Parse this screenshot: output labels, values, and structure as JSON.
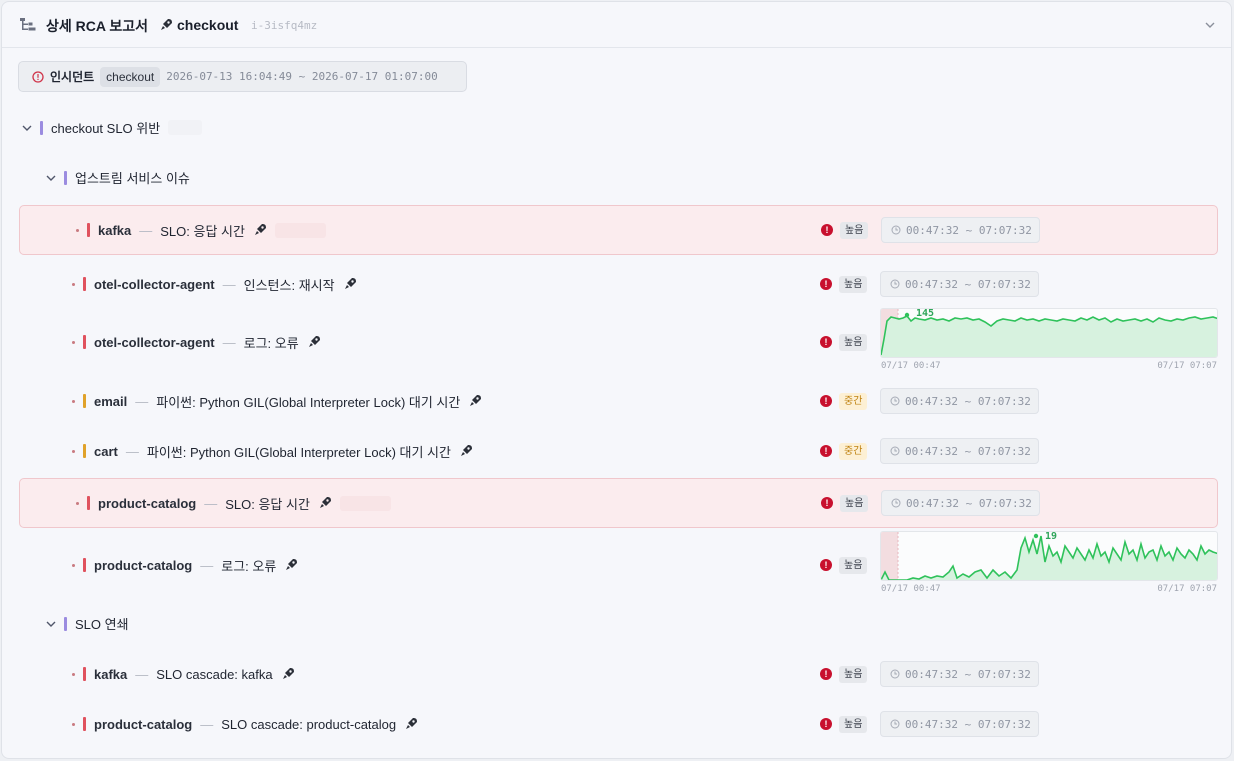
{
  "header": {
    "title": "상세 RCA 보고서",
    "service": "checkout",
    "instance_id": "i-3isfq4mz"
  },
  "incident": {
    "label": "인시던트",
    "service": "checkout",
    "range": "2026-07-13 16:04:49 ~ 2026-07-17 01:07:00"
  },
  "tree": {
    "root": {
      "label": "checkout SLO 위반"
    },
    "group1": {
      "label": "업스트림 서비스 이슈"
    },
    "group2": {
      "label": "SLO 연쇄"
    }
  },
  "rows": [
    {
      "service": "kafka",
      "desc": "SLO: 응답 시간",
      "severity": "높음",
      "time": "00:47:32 ~ 07:07:32"
    },
    {
      "service": "otel-collector-agent",
      "desc": "인스턴스: 재시작",
      "severity": "높음",
      "time": "00:47:32 ~ 07:07:32"
    },
    {
      "service": "otel-collector-agent",
      "desc": "로그: 오류",
      "severity": "높음",
      "spark_start": "07/17 00:47",
      "spark_end": "07/17 07:07",
      "spark_peak": "145"
    },
    {
      "service": "email",
      "desc": "파이썬: Python GIL(Global Interpreter Lock) 대기 시간",
      "severity": "중간",
      "time": "00:47:32 ~ 07:07:32"
    },
    {
      "service": "cart",
      "desc": "파이썬: Python GIL(Global Interpreter Lock) 대기 시간",
      "severity": "중간",
      "time": "00:47:32 ~ 07:07:32"
    },
    {
      "service": "product-catalog",
      "desc": "SLO: 응답 시간",
      "severity": "높음",
      "time": "00:47:32 ~ 07:07:32"
    },
    {
      "service": "product-catalog",
      "desc": "로그: 오류",
      "severity": "높음",
      "spark_start": "07/17 00:47",
      "spark_end": "07/17 07:07",
      "spark_peak": "19"
    },
    {
      "service": "kafka",
      "desc": "SLO cascade: kafka",
      "severity": "높음",
      "time": "00:47:32 ~ 07:07:32"
    },
    {
      "service": "product-catalog",
      "desc": "SLO cascade: product-catalog",
      "severity": "높음",
      "time": "00:47:32 ~ 07:07:32"
    }
  ],
  "colors": {
    "severity_high_bar": "#e0525e",
    "severity_mid_bar": "#e0a22a",
    "tree_bar": "#9b8ce0",
    "spark_line": "#2fc25b",
    "highlight_bg": "#fbecee"
  },
  "icons": {
    "header": "tree-structure-icon",
    "service": "rocket-icon",
    "incident": "alert-circle-icon",
    "time": "clock-icon",
    "collapse": "chevron-down-icon"
  }
}
